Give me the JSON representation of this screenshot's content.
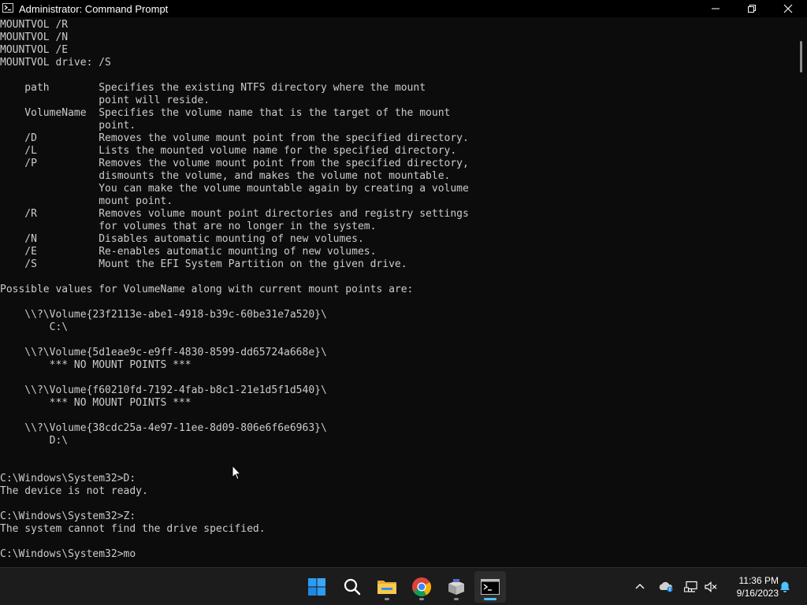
{
  "window": {
    "title": "Administrator: Command Prompt",
    "controls": {
      "minimize": "minimize",
      "maximize": "restore",
      "close": "close"
    }
  },
  "terminal": {
    "lines": [
      "MOUNTVOL /R",
      "MOUNTVOL /N",
      "MOUNTVOL /E",
      "MOUNTVOL drive: /S",
      "",
      "    path        Specifies the existing NTFS directory where the mount",
      "                point will reside.",
      "    VolumeName  Specifies the volume name that is the target of the mount",
      "                point.",
      "    /D          Removes the volume mount point from the specified directory.",
      "    /L          Lists the mounted volume name for the specified directory.",
      "    /P          Removes the volume mount point from the specified directory,",
      "                dismounts the volume, and makes the volume not mountable.",
      "                You can make the volume mountable again by creating a volume",
      "                mount point.",
      "    /R          Removes volume mount point directories and registry settings",
      "                for volumes that are no longer in the system.",
      "    /N          Disables automatic mounting of new volumes.",
      "    /E          Re-enables automatic mounting of new volumes.",
      "    /S          Mount the EFI System Partition on the given drive.",
      "",
      "Possible values for VolumeName along with current mount points are:",
      "",
      "    \\\\?\\Volume{23f2113e-abe1-4918-b39c-60be31e7a520}\\",
      "        C:\\",
      "",
      "    \\\\?\\Volume{5d1eae9c-e9ff-4830-8599-dd65724a668e}\\",
      "        *** NO MOUNT POINTS ***",
      "",
      "    \\\\?\\Volume{f60210fd-7192-4fab-b8c1-21e1d5f1d540}\\",
      "        *** NO MOUNT POINTS ***",
      "",
      "    \\\\?\\Volume{38cdc25a-4e97-11ee-8d09-806e6f6e6963}\\",
      "        D:\\",
      "",
      "",
      "C:\\Windows\\System32>D:",
      "The device is not ready.",
      "",
      "C:\\Windows\\System32>Z:",
      "The system cannot find the drive specified.",
      "",
      "C:\\Windows\\System32>mo"
    ]
  },
  "taskbar": {
    "apps": [
      {
        "name": "start-button",
        "icon": "windows-logo-icon"
      },
      {
        "name": "search-button",
        "icon": "search-icon"
      },
      {
        "name": "file-explorer",
        "icon": "folder-icon"
      },
      {
        "name": "chrome",
        "icon": "chrome-icon"
      },
      {
        "name": "installer-app",
        "icon": "package-icon"
      },
      {
        "name": "command-prompt",
        "icon": "terminal-icon",
        "active": true
      }
    ],
    "tray": [
      "chevron-up-icon",
      "onedrive-icon",
      "network-icon",
      "volume-muted-icon",
      "notification-bell-icon"
    ],
    "clock": {
      "time": "11:36 PM",
      "date": "9/16/2023"
    }
  },
  "colors": {
    "terminal_bg": "#0c0c0c",
    "terminal_fg": "#cccccc",
    "taskbar_bg": "#1c1c1c",
    "accent": "#4cc2ff"
  }
}
